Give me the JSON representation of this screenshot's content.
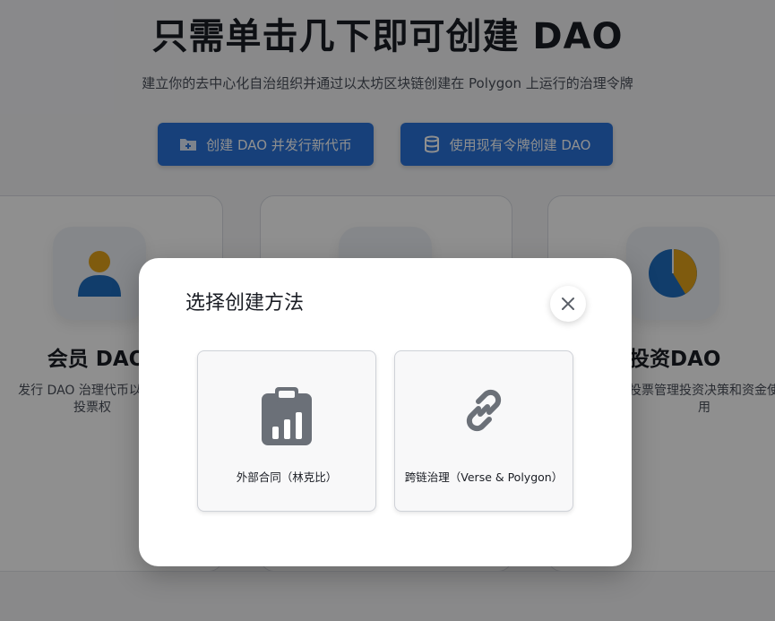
{
  "hero": {
    "title": "只需单击几下即可创建 DAO",
    "subtitle": "建立你的去中心化自治组织并通过以太坊区块链创建在 Polygon 上运行的治理令牌"
  },
  "actions": {
    "create_label": "创建 DAO 并发行新代币",
    "existing_label": "使用现有令牌创建 DAO"
  },
  "cards": {
    "member": {
      "title": "会员 DAO",
      "desc_line1": "发行 DAO 治理代币以代表",
      "desc_line2": "投票权"
    },
    "investment": {
      "title": "投资DAO",
      "desc_line1": "投票管理投资决策和资金使",
      "desc_line2": "用"
    }
  },
  "modal": {
    "title": "选择创建方法",
    "options": [
      {
        "label": "外部合同（林克比）",
        "icon": "clipboard-chart-icon"
      },
      {
        "label": "跨链治理（Verse & Polygon）",
        "icon": "link-icon"
      }
    ]
  },
  "colors": {
    "primary": "#2a73d9",
    "icon_gray": "#6b7078",
    "overlay": "rgba(0,0,0,0.44)"
  }
}
